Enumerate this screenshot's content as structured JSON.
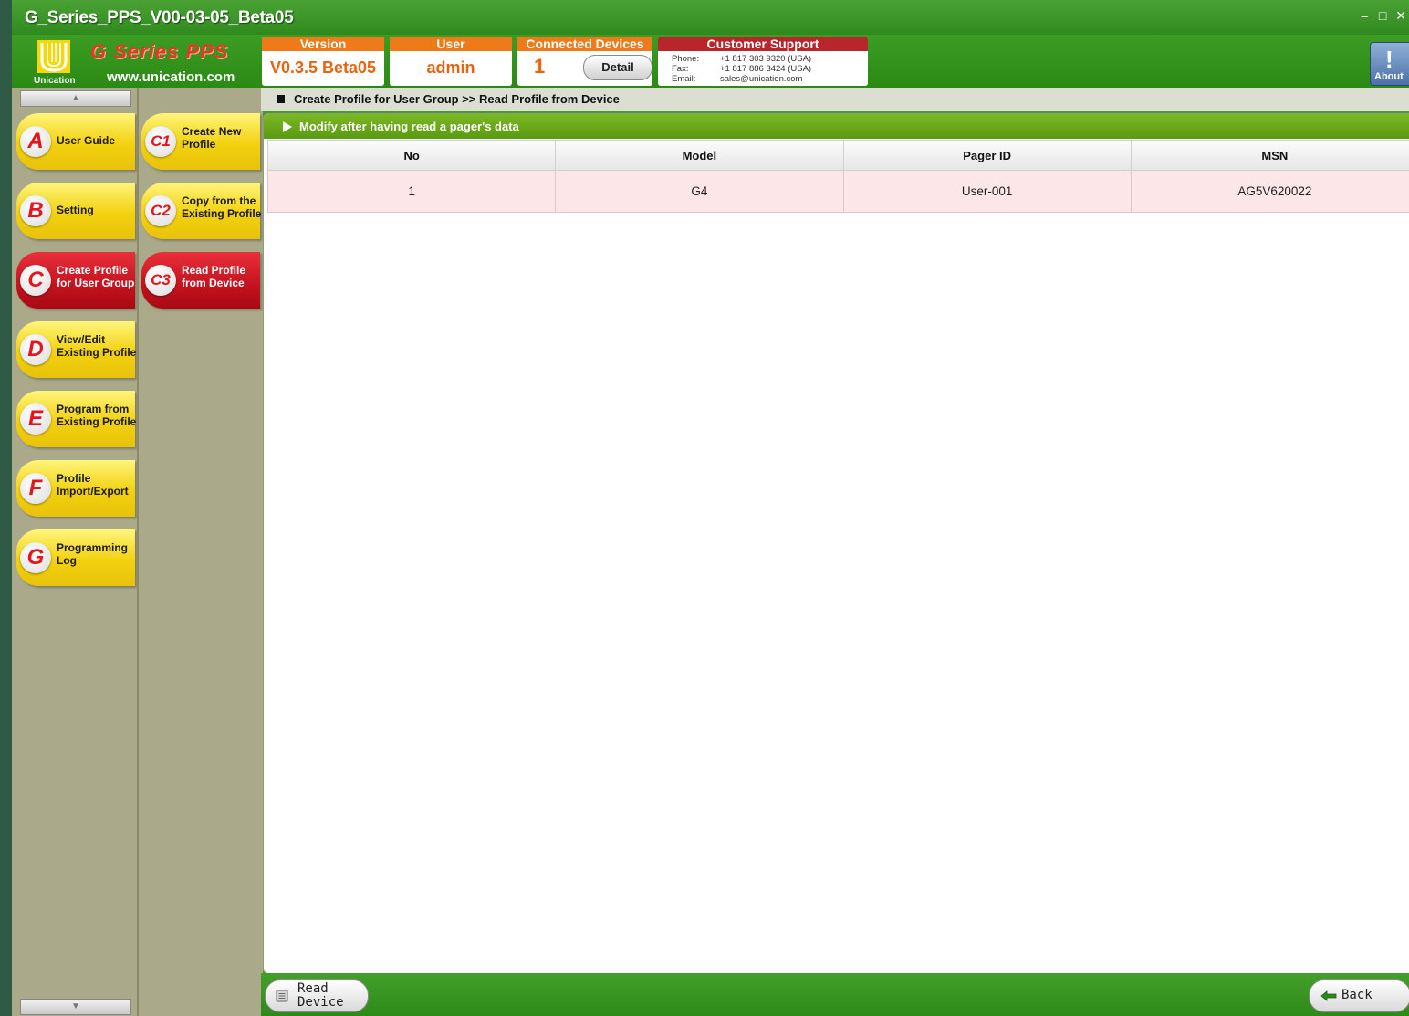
{
  "window": {
    "title": "G_Series_PPS_V00-03-05_Beta05",
    "controls": {
      "minimize": "–",
      "maximize": "□",
      "close": "✕"
    }
  },
  "header": {
    "logo_text": "Unication",
    "brand": "G Series PPS",
    "website": "www.unication.com",
    "version": {
      "label": "Version",
      "value": "V0.3.5 Beta05"
    },
    "user": {
      "label": "User",
      "value": "admin"
    },
    "connected": {
      "label": "Connected Devices",
      "value": "1",
      "detail_label": "Detail"
    },
    "support": {
      "label": "Customer Support",
      "phone_label": "Phone:",
      "phone": "+1 817 303 9320 (USA)",
      "fax_label": "Fax:",
      "fax": "+1 817 886 3424 (USA)",
      "email_label": "Email:",
      "email": "sales@unication.com"
    },
    "about_label": "About"
  },
  "sidebar": {
    "scroll_up": "▲",
    "scroll_down": "▼",
    "items": [
      {
        "letter": "A",
        "label": "User Guide",
        "active": false
      },
      {
        "letter": "B",
        "label": "Setting",
        "active": false
      },
      {
        "letter": "C",
        "label": "Create Profile for User Group",
        "active": true
      },
      {
        "letter": "D",
        "label": "View/Edit Existing Profile",
        "active": false
      },
      {
        "letter": "E",
        "label": "Program from Existing Profile",
        "active": false
      },
      {
        "letter": "F",
        "label": "Profile Import/Export",
        "active": false
      },
      {
        "letter": "G",
        "label": "Programming Log",
        "active": false
      }
    ],
    "subitems": [
      {
        "letter": "C1",
        "label": "Create New Profile",
        "active": false
      },
      {
        "letter": "C2",
        "label": "Copy from the Existing Profile",
        "active": false
      },
      {
        "letter": "C3",
        "label": "Read Profile from Device",
        "active": true
      }
    ]
  },
  "main": {
    "breadcrumb": "Create Profile for User Group >> Read Profile from Device",
    "panel_title": "Modify after having read a pager's data",
    "table": {
      "columns": [
        "No",
        "Model",
        "Pager ID",
        "MSN"
      ],
      "rows": [
        [
          "1",
          "G4",
          "User-001",
          "AG5V620022"
        ]
      ]
    }
  },
  "footer": {
    "read_device": "Read Device",
    "back": "Back"
  },
  "colors": {
    "accent_green": "#3c9c24",
    "accent_orange": "#ee7a1a",
    "accent_red": "#b8262c",
    "menu_yellow": "#f2d10e",
    "menu_active_red": "#c4121e",
    "row_highlight": "#fde6e8"
  }
}
